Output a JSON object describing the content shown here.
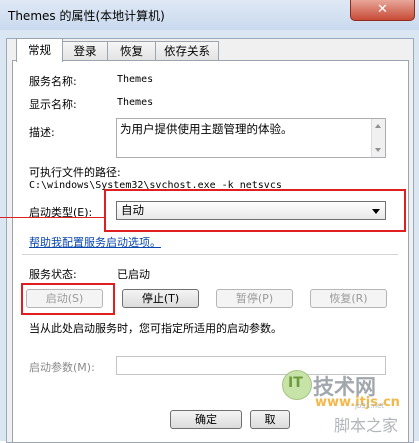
{
  "window": {
    "title": "Themes 的属性(本地计算机)",
    "close_glyph": "✕"
  },
  "tabs": [
    "常规",
    "登录",
    "恢复",
    "依存关系"
  ],
  "general": {
    "service_name_label": "服务名称:",
    "service_name": "Themes",
    "display_name_label": "显示名称:",
    "display_name": "Themes",
    "description_label": "描述:",
    "description": "为用户提供使用主题管理的体验。",
    "path_label": "可执行文件的路径:",
    "path": "C:\\windows\\System32\\svchost.exe -k netsvcs",
    "startup_type_label": "启动类型(E):",
    "startup_type": "自动",
    "help_link": "帮助我配置服务启动选项。",
    "status_label": "服务状态:",
    "status": "已启动",
    "start_button": "启动(S)",
    "stop_button": "停止(T)",
    "pause_button": "暂停(P)",
    "resume_button": "恢复(R)",
    "hint": "当从此处启动服务时，您可指定所适用的启动参数。",
    "params_label": "启动参数(M):",
    "params_value": ""
  },
  "footer": {
    "ok_button": "确定",
    "cancel_button": "取"
  },
  "watermark": {
    "logo_text": "IT",
    "brand": "技术网",
    "url": "www.itjs.cn",
    "corner": "脚本之家",
    "corner_url": "jb51.net"
  }
}
